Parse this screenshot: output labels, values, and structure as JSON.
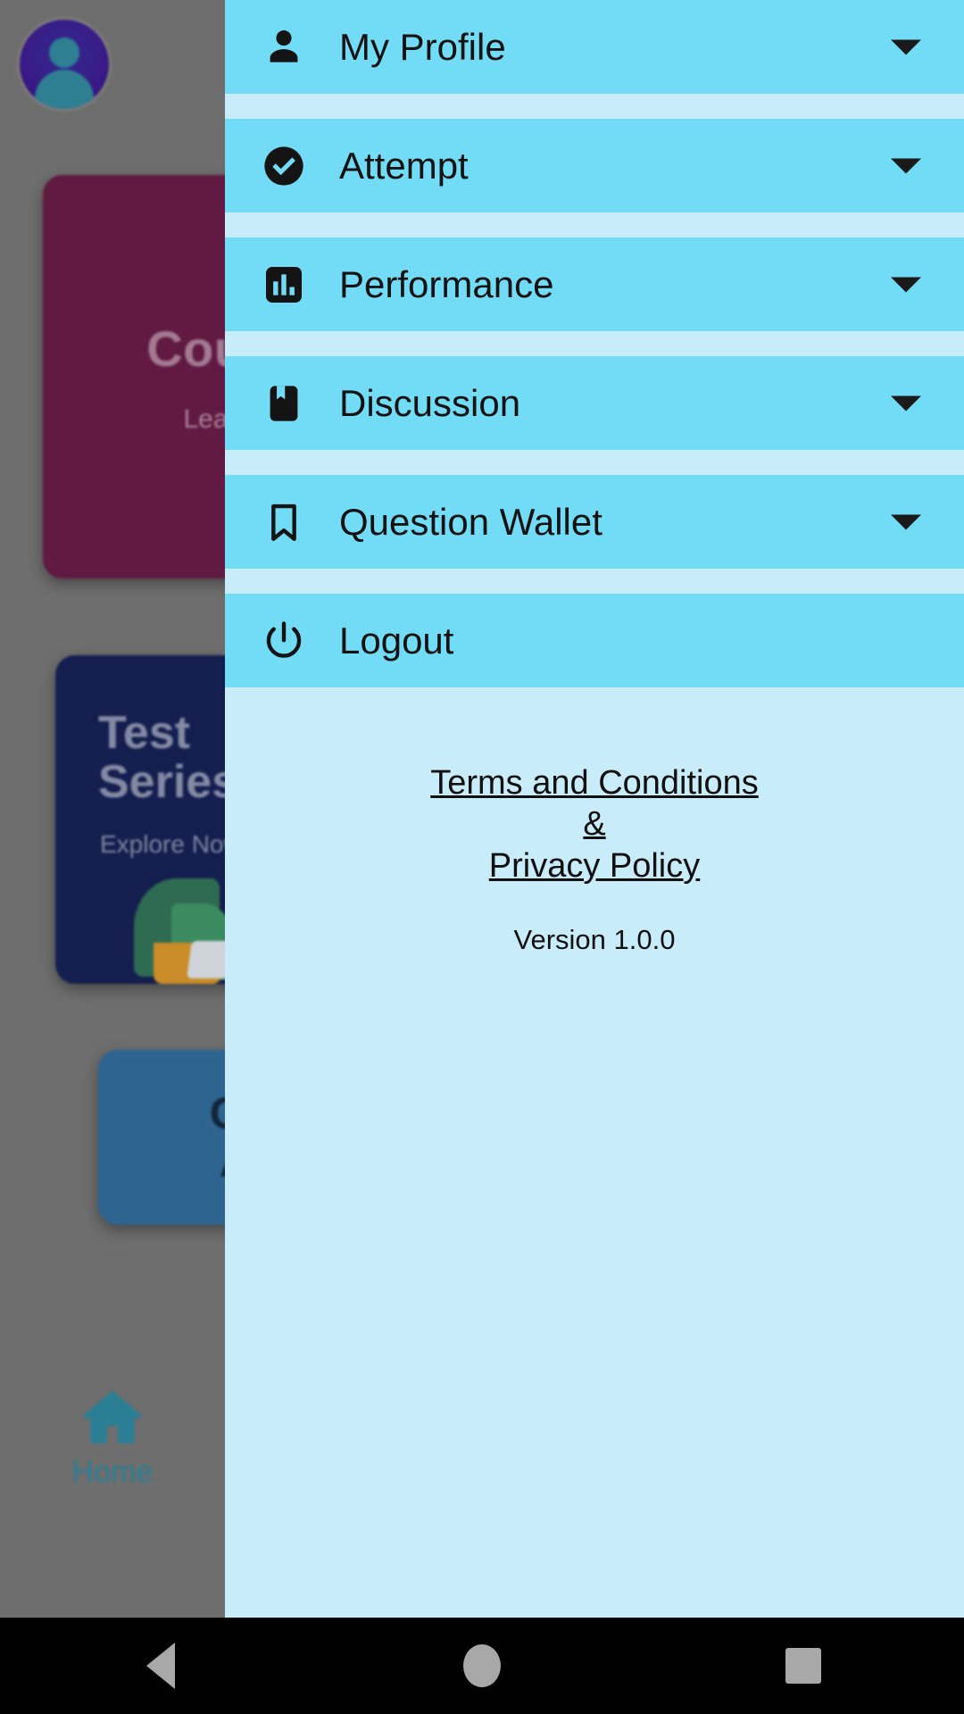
{
  "app": {
    "drawer_bg": "#c9ecfb",
    "row_bg": "#72dbf5",
    "accent": "#2a7f95"
  },
  "background_app": {
    "avatar_name": "user-avatar",
    "cards": [
      {
        "title": "Courses",
        "subtitle": "Learn Now",
        "color": "#611a42"
      },
      {
        "title_line1": "Test",
        "title_line2": "Series",
        "subtitle": "Explore Now >",
        "color": "#141f4f"
      },
      {
        "title_line1": "Current",
        "title_line2": "Affairs",
        "color": "#2e6490"
      }
    ],
    "bottom_nav": [
      {
        "label": "Home",
        "icon": "home-icon"
      }
    ]
  },
  "drawer": {
    "items": [
      {
        "label": "My Profile",
        "icon": "person-icon",
        "has_chevron": true
      },
      {
        "label": "Attempt",
        "icon": "check-circle-icon",
        "has_chevron": true
      },
      {
        "label": "Performance",
        "icon": "bar-chart-icon",
        "has_chevron": true
      },
      {
        "label": "Discussion",
        "icon": "book-bookmark-icon",
        "has_chevron": true
      },
      {
        "label": "Question Wallet",
        "icon": "bookmark-icon",
        "has_chevron": true
      },
      {
        "label": "Logout",
        "icon": "power-icon",
        "has_chevron": false
      }
    ],
    "footer": {
      "terms_label": "Terms and Conditions",
      "ampersand": "&",
      "privacy_label": "Privacy Policy",
      "version": "Version 1.0.0"
    }
  },
  "system_nav": {
    "back": "back-button",
    "home": "home-button",
    "recents": "recents-button"
  }
}
